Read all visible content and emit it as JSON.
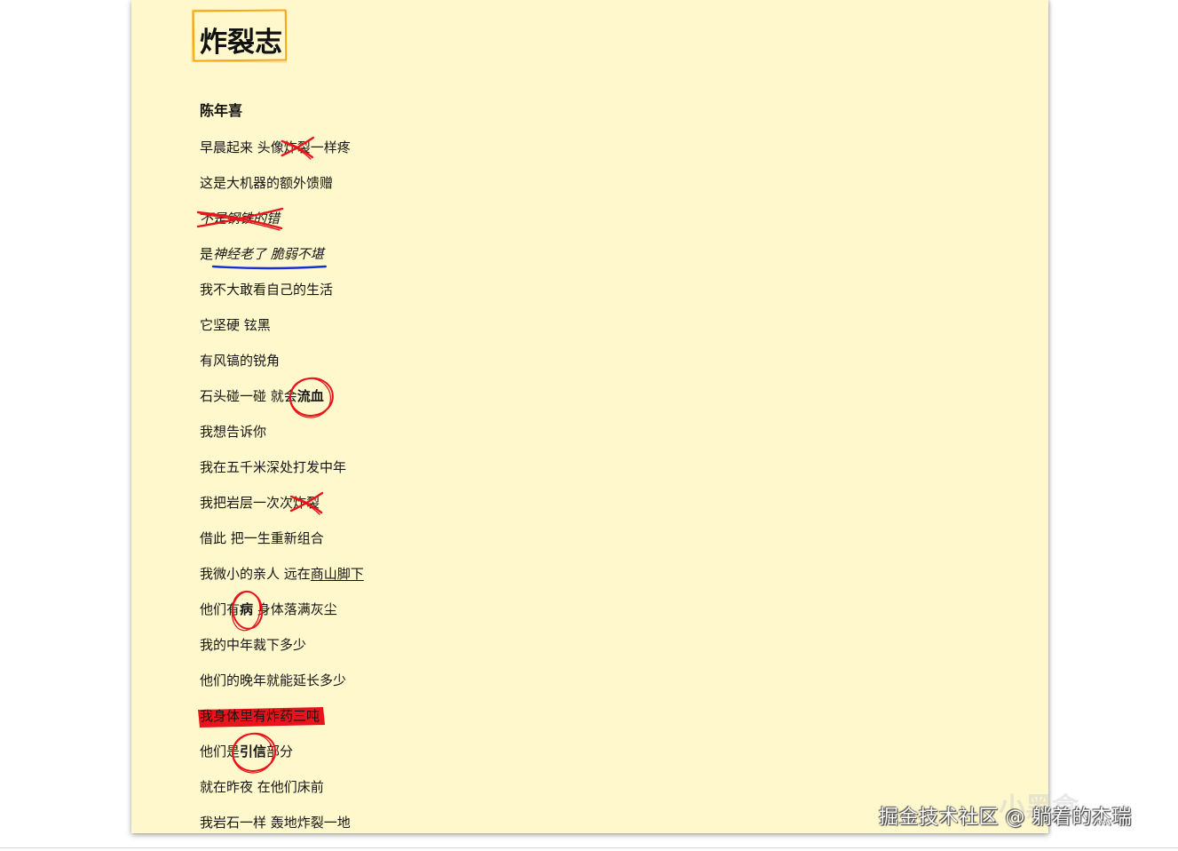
{
  "document": {
    "title": "炸裂志",
    "author": "陈年喜"
  },
  "poem": {
    "lines": [
      {
        "segments": [
          {
            "text": "早晨起来 头像"
          },
          {
            "text": "炸裂",
            "mark": "cross"
          },
          {
            "text": "一样疼"
          }
        ]
      },
      {
        "segments": [
          {
            "text": "这是大机器的额外馈赠"
          }
        ]
      },
      {
        "segments": [
          {
            "text": "不是钢铁的错",
            "mark": "cross",
            "style": "italic"
          }
        ]
      },
      {
        "segments": [
          {
            "text": "是"
          },
          {
            "text": "神经老了 脆弱不堪",
            "mark": "underline-blue",
            "style": "italic"
          }
        ]
      },
      {
        "segments": [
          {
            "text": "我不大敢看自己的生活"
          }
        ]
      },
      {
        "segments": [
          {
            "text": "它坚硬 铉黑"
          }
        ]
      },
      {
        "segments": [
          {
            "text": "有风镐的锐角"
          }
        ]
      },
      {
        "segments": [
          {
            "text": "石头碰一碰 就会"
          },
          {
            "text": "流血",
            "mark": "circle",
            "style": "bold"
          }
        ]
      },
      {
        "segments": [
          {
            "text": "我想告诉你"
          }
        ]
      },
      {
        "segments": [
          {
            "text": "我在五千米深处打发中年"
          }
        ]
      },
      {
        "segments": [
          {
            "text": "我把岩层一次次"
          },
          {
            "text": "炸裂",
            "mark": "cross"
          }
        ]
      },
      {
        "segments": [
          {
            "text": "借此 把一生重新组合"
          }
        ]
      },
      {
        "segments": [
          {
            "text": "我微小的亲人 远在"
          },
          {
            "text": "商山脚下",
            "style": "underline"
          }
        ]
      },
      {
        "segments": [
          {
            "text": "他们有"
          },
          {
            "text": "病",
            "mark": "circle",
            "style": "bold"
          },
          {
            "text": " 身体落满灰尘"
          }
        ]
      },
      {
        "segments": [
          {
            "text": "我的中年裁下多少"
          }
        ]
      },
      {
        "segments": [
          {
            "text": "他们的晚年就能延长多少"
          }
        ]
      },
      {
        "segments": [
          {
            "text": "我身体里有炸药三吨",
            "mark": "highlight-red"
          }
        ]
      },
      {
        "segments": [
          {
            "text": "他们是"
          },
          {
            "text": "引信",
            "mark": "circle",
            "style": "bold"
          },
          {
            "text": "部分"
          }
        ]
      },
      {
        "segments": [
          {
            "text": "就在昨夜 在他们床前"
          }
        ]
      },
      {
        "segments": [
          {
            "text": "我岩石一样 轰地炸裂一地"
          }
        ]
      }
    ]
  },
  "watermark": {
    "text": "掘金技术社区 @ 躺着的杰瑞",
    "logo": "小黑盒"
  },
  "colors": {
    "page_background": "#fff8cc",
    "title_box": "#f5a816",
    "mark_red": "#e8141b",
    "mark_blue": "#1530d8"
  }
}
